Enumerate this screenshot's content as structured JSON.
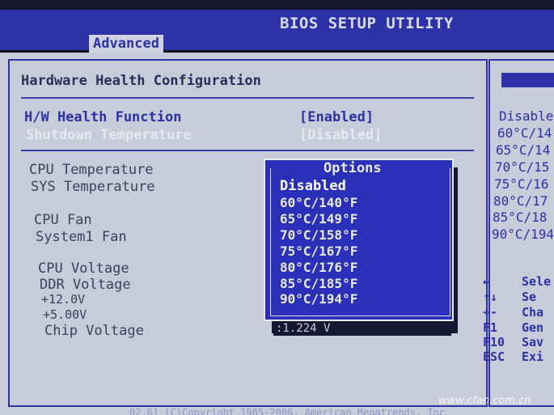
{
  "header": {
    "title": "BIOS SETUP UTILITY",
    "active_tab": "Advanced"
  },
  "page": {
    "heading": "Hardware Health Configuration"
  },
  "settings": [
    {
      "label": "H/W Health Function",
      "value": "[Enabled]"
    },
    {
      "label": "Shutdown Temperature",
      "value": "[Disabled]"
    }
  ],
  "monitors": {
    "cpu_temp": "CPU Temperature",
    "sys_temp": "SYS Temperature",
    "cpu_fan": "CPU Fan",
    "sys_fan": "System1 Fan",
    "cpu_voltage": "CPU Voltage",
    "ddr_voltage": "DDR Voltage",
    "v12": "+12.0V",
    "v5": "+5.00V",
    "chip_voltage": "Chip Voltage",
    "chip_voltage_value": ":1.224 V"
  },
  "dropdown": {
    "title": "Options",
    "selected": "Disabled",
    "options": [
      "Disabled",
      "60°C/140°F",
      "65°C/149°F",
      "70°C/158°F",
      "75°C/167°F",
      "80°C/176°F",
      "85°C/185°F",
      "90°C/194°F"
    ]
  },
  "right_panel": {
    "options": [
      "Disable",
      "60°C/14",
      "65°C/14",
      "70°C/15",
      "75°C/16",
      "80°C/17",
      "85°C/18",
      "90°C/194"
    ],
    "help": [
      {
        "key": "←",
        "text": "Sele"
      },
      {
        "key": "↑↓",
        "text": "Se"
      },
      {
        "key": "+-",
        "text": "Cha"
      },
      {
        "key": "F1",
        "text": "Gen"
      },
      {
        "key": "F10",
        "text": "Sav"
      },
      {
        "key": "ESC",
        "text": "Exi"
      }
    ]
  },
  "footer": {
    "text": "02.61 (C)Copyright 1985-2006, American Megatrends, Inc"
  },
  "watermark": "www.cfan.com.cn",
  "colors": {
    "bios_blue": "#2d33a6",
    "panel_grey": "#c8cbd8",
    "dropdown_blue": "#2a31b8"
  }
}
